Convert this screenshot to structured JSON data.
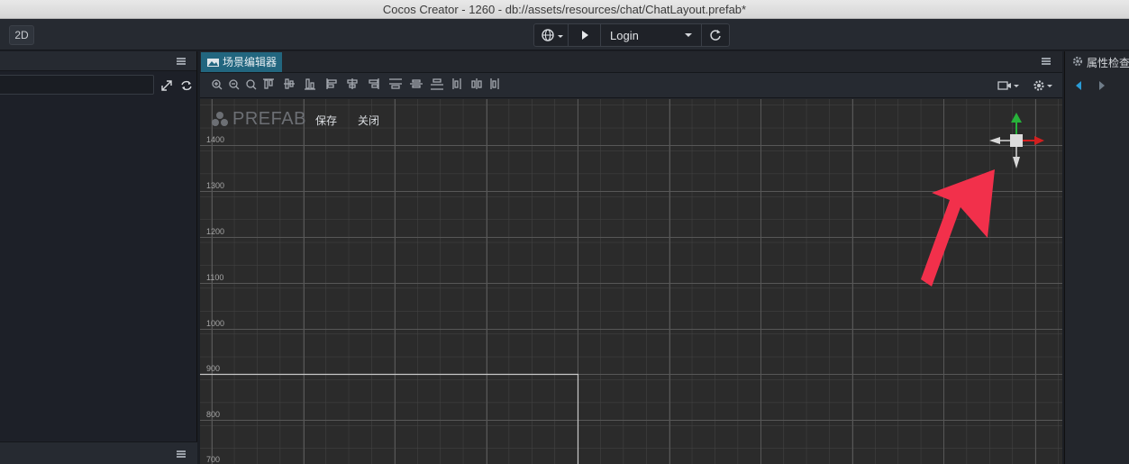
{
  "window": {
    "title": "Cocos Creator - 1260 - db://assets/resources/chat/ChatLayout.prefab*"
  },
  "toolbar": {
    "mode_2d": "2D",
    "globe_icon": "globe-icon",
    "play_icon": "play-icon",
    "platform_select": "Login",
    "refresh_icon": "refresh-icon"
  },
  "scene_panel": {
    "tab_label": "场景编辑器",
    "prefab_mode_label": "PREFAB",
    "save_button": "保存",
    "close_button": "关闭",
    "y_axis_labels": [
      "1400",
      "1300",
      "1200",
      "1100",
      "1000",
      "900",
      "800",
      "700"
    ]
  },
  "inspector_panel": {
    "title": "属性检查"
  },
  "colors": {
    "accent_tab": "#22667f",
    "annotation_arrow": "#f2304b",
    "gizmo_x": "#d21f1f",
    "gizmo_y": "#27b23a"
  }
}
